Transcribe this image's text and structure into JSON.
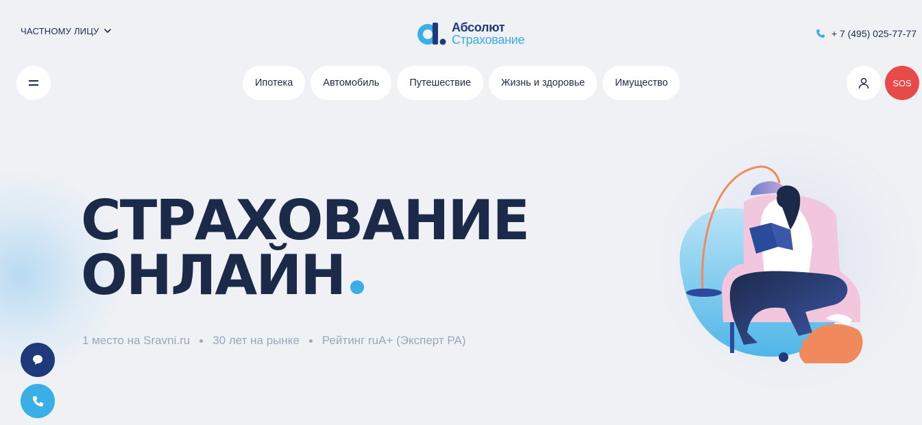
{
  "header": {
    "client_type": "ЧАСТНОМУ ЛИЦУ",
    "logo": {
      "line1": "Абсолют",
      "line2": "Страхование"
    },
    "phone": "+ 7 (495) 025-77-77"
  },
  "nav": {
    "items": [
      "Ипотека",
      "Автомобиль",
      "Путешествие",
      "Жизнь и здоровье",
      "Имущество"
    ],
    "sos_label": "SOS"
  },
  "hero": {
    "title_line1": "СТРАХОВАНИЕ",
    "title_line2": "ОНЛАЙН",
    "facts": [
      "1 место на Sravni.ru",
      "30 лет на рынке",
      "Рейтинг ruA+ (Эксперт РА)"
    ]
  },
  "colors": {
    "background": "#eff1f5",
    "navy": "#1c2a4a",
    "brand_blue": "#1f3a7a",
    "accent_cyan": "#3aaee6",
    "sos_red": "#e84a4a",
    "muted_text": "#9aa7bd"
  },
  "icons": {
    "client_switch": "chevron-down-icon",
    "phone": "phone-icon",
    "menu": "menu-icon",
    "user": "user-icon",
    "chat": "chat-icon",
    "call": "phone-icon"
  }
}
